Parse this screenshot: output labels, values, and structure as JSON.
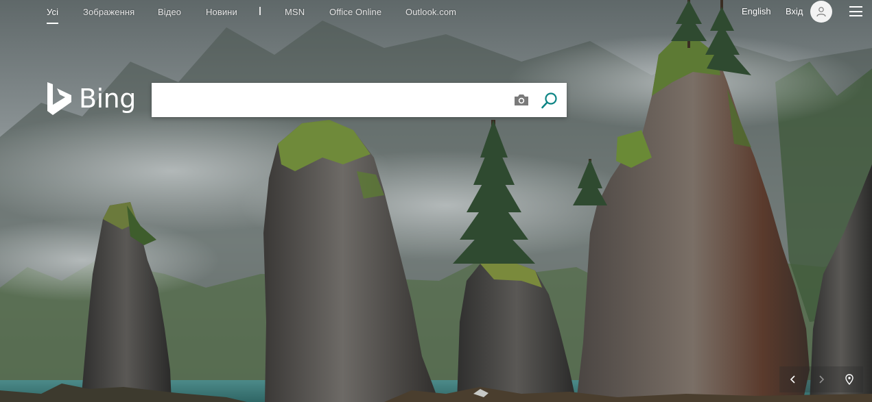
{
  "nav": {
    "items": [
      {
        "label": "Усі",
        "active": true
      },
      {
        "label": "Зображення"
      },
      {
        "label": "Відео"
      },
      {
        "label": "Новини"
      },
      {
        "label": "MSN"
      },
      {
        "label": "Office Online"
      },
      {
        "label": "Outlook.com"
      }
    ],
    "language": "English",
    "signin": "Вхід",
    "avatar_icon": "user-icon",
    "menu_icon": "hamburger-menu-icon"
  },
  "logo": {
    "text": "Bing",
    "icon": "bing-logo-icon"
  },
  "search": {
    "value": "",
    "placeholder": "",
    "camera_icon": "camera-icon",
    "search_icon": "search-icon",
    "accent": "#0c8484"
  },
  "background": {
    "description_colors": [
      "#7d8587",
      "#3c3d3b",
      "#4f6b3a",
      "#2f6f6e"
    ]
  },
  "controls": {
    "prev_icon": "chevron-left-icon",
    "next_icon": "chevron-right-icon",
    "location_icon": "location-pin-icon"
  }
}
